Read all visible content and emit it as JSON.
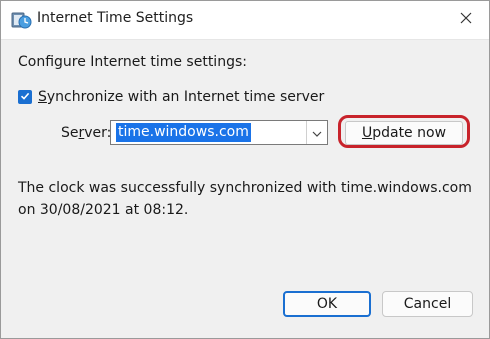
{
  "window": {
    "title": "Internet Time Settings"
  },
  "content": {
    "heading": "Configure Internet time settings:",
    "sync_checkbox": {
      "checked": true,
      "label_accel": "S",
      "label_rest": "ynchronize with an Internet time server"
    },
    "server": {
      "label_accel": "Se",
      "label_u": "r",
      "label_rest": "ver:",
      "value": "time.windows.com"
    },
    "update_button": {
      "accel": "U",
      "rest": "pdate now"
    },
    "status_text": "The clock was successfully synchronized with time.windows.com on 30/08/2021 at 08:12."
  },
  "buttons": {
    "ok": "OK",
    "cancel": "Cancel"
  },
  "colors": {
    "accent": "#1a6fd1",
    "highlight_ring": "#c8232b",
    "selection": "#1a73e8"
  },
  "icons": {
    "app": "clock-globe-icon",
    "close": "close-icon",
    "dropdown": "chevron-down-icon",
    "check": "checkmark-icon"
  }
}
